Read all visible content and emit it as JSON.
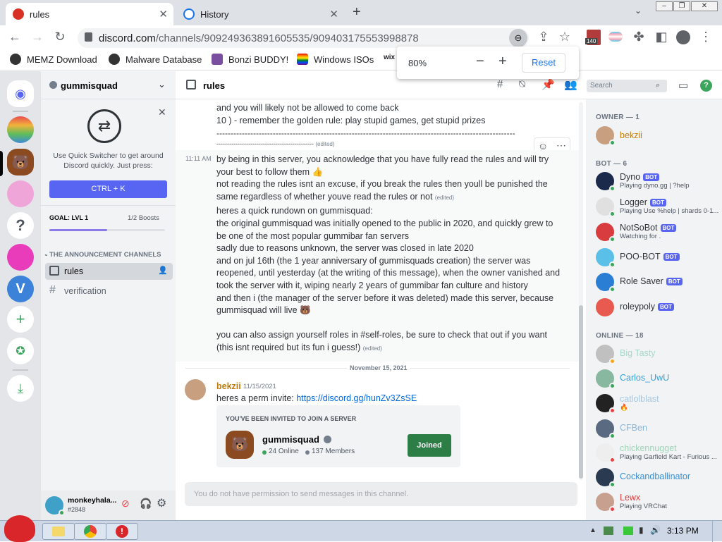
{
  "browser": {
    "tabs": [
      {
        "label": "rules"
      },
      {
        "label": "History"
      }
    ],
    "url_host": "discord.com",
    "url_path": "/channels/909249363891605535/909403175553998878",
    "bookmarks": [
      {
        "label": "MEMZ Download"
      },
      {
        "label": "Malware Database"
      },
      {
        "label": "Bonzi BUDDY!"
      },
      {
        "label": "Windows ISOs"
      },
      {
        "label": "wix"
      }
    ],
    "extension_badge": "140",
    "zoom": {
      "level": "80%",
      "reset_label": "Reset"
    }
  },
  "server": {
    "name": "gummisquad",
    "quick_switcher_text_1": "Use Quick Switcher to get around",
    "quick_switcher_text_2": "Discord quickly. Just press:",
    "quick_switcher_button": "CTRL + K",
    "goal_label": "GOAL: LVL 1",
    "boosts": "1/2 Boosts",
    "boost_progress": 0.5,
    "category": "THE ANNOUNCEMENT CHANNELS",
    "channels": [
      {
        "name": "rules",
        "selected": true
      },
      {
        "name": "verification",
        "selected": false
      }
    ]
  },
  "user": {
    "name": "monkeyhala...",
    "tag": "#2848"
  },
  "chat": {
    "channel_name": "rules",
    "search_placeholder": "Search",
    "lines_top": [
      "and you will likely not be allowed to come back",
      "10 ) - remember the golden rule: play stupid games, get stupid prizes",
      "----------------------------------------------------------------------------------------------------------",
      "----------------------------------------------"
    ],
    "time_1": "11:11 AM",
    "lines_mid": [
      "by being in this server, you acknowledge that you have fully read the rules and will try",
      "your best to follow them",
      "not reading the rules isnt an excuse, if you break the rules then youll be punished the",
      "same regardless of whether youve read the rules or not",
      "heres a quick rundown on gummisquad:",
      "the original gummisquad was initially opened to the public in 2020, and quickly grew to",
      "be one of the most popular gummibar fan servers",
      "sadly due to reasons unknown, the server was closed in late 2020",
      "and on jul 16th (the 1 year anniversary of gummisquads creation) the server was",
      "reopened, until yesterday (at the writing of this message), when the owner vanished and",
      "took the server with it, wiping nearly 2 years of gummibar fan culture and history",
      "and then i (the manager of the server before it was deleted) made this server, because",
      "gummisquad will live",
      "you can also assign yourself roles in #self-roles, be sure to check that out if you want",
      "(this isnt required but its fun i guess!)"
    ],
    "edited_label": "(edited)",
    "date_divider": "November 15, 2021",
    "author": "bekzii",
    "author_date": "11/15/2021",
    "invite_text": "heres a perm invite:",
    "invite_link": "https://discord.gg/hunZv3ZsSE",
    "invite_header": "YOU'VE BEEN INVITED TO JOIN A SERVER",
    "invite_server": "gummisquad",
    "invite_online": "24 Online",
    "invite_members": "137 Members",
    "invite_button": "Joined",
    "composer_placeholder": "You do not have permission to send messages in this channel."
  },
  "members": {
    "owner_header": "OWNER — 1",
    "bot_header": "BOT — 6",
    "online_header": "ONLINE — 18",
    "bot_label": "BOT",
    "owner": [
      {
        "name": "bekzii",
        "color": "#c27c0e"
      }
    ],
    "bots": [
      {
        "name": "Dyno",
        "status": "Playing dyno.gg | ?help"
      },
      {
        "name": "Logger",
        "status": "Playing Use %help | shards 0-1..."
      },
      {
        "name": "NotSoBot",
        "status": "Watching for ."
      },
      {
        "name": "POO-BOT",
        "status": ""
      },
      {
        "name": "Role Saver",
        "status": ""
      },
      {
        "name": "roleypoly",
        "status": ""
      }
    ],
    "online": [
      {
        "name": "Big Tasty",
        "status": "",
        "color": "#a5d8c8"
      },
      {
        "name": "Carlos_UwU",
        "status": "",
        "color": "#3aa0d8"
      },
      {
        "name": "catlolblast",
        "status": "",
        "color": "#a7c7e0"
      },
      {
        "name": "CFBen",
        "status": "",
        "color": "#8ab7d9"
      },
      {
        "name": "chickennugget",
        "status": "Playing Garfield Kart - Furious ...",
        "color": "#9fd4b8"
      },
      {
        "name": "Cockandballinator",
        "status": "",
        "color": "#3a8fd0"
      },
      {
        "name": "Lewx",
        "status": "Playing VRChat",
        "color": "#d83c3e"
      }
    ]
  },
  "taskbar": {
    "time": "3:13 PM"
  }
}
